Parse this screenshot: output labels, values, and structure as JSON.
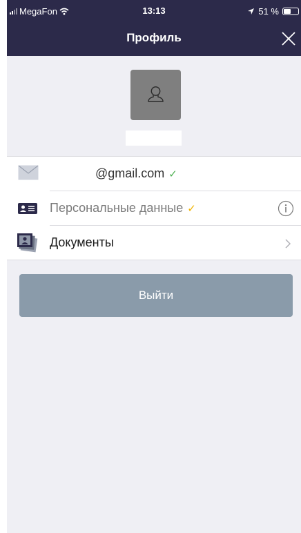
{
  "status_bar": {
    "carrier": "MegaFon",
    "time": "13:13",
    "battery": "51 %",
    "battery_level": 0.51
  },
  "nav": {
    "title": "Профиль"
  },
  "rows": [
    {
      "label": "@gmail.com",
      "check": "✓",
      "check_color": "#4caf50"
    },
    {
      "label": "Персональные данные",
      "check": "✓",
      "check_color": "#f0b400"
    },
    {
      "label": "Документы"
    }
  ],
  "logout_label": "Выйти",
  "colors": {
    "nav_bg": "#2c2a4a",
    "button_bg": "#8a9baa",
    "background": "#efeff4",
    "avatar_bg": "#7f7f7f"
  },
  "icons": [
    "wifi-icon",
    "location-arrow-icon",
    "battery-icon",
    "close-icon",
    "user-icon",
    "mail-icon",
    "id-card-icon",
    "info-icon",
    "documents-icon",
    "chevron-right-icon"
  ]
}
